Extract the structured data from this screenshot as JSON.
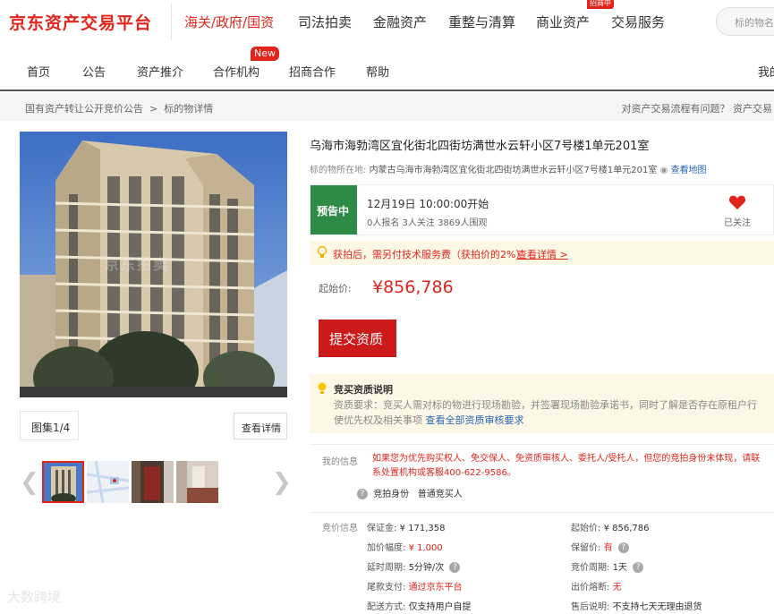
{
  "header": {
    "logo": "京东资产交易平台",
    "nav": [
      "海关/政府/国资",
      "司法拍卖",
      "金融资产",
      "重整与清算",
      "商业资产",
      "交易服务"
    ],
    "badge": "招商中",
    "search_placeholder": "标的物名称"
  },
  "subnav": {
    "items": [
      "首页",
      "公告",
      "资产推介",
      "合作机构",
      "招商合作",
      "帮助"
    ],
    "new_badge": "New",
    "right_text": "我的"
  },
  "breadcrumb": {
    "items": [
      "国有资产转让公开竞价公告",
      "标的物详情"
    ],
    "help": "对资产交易流程有问题？ 资产交易"
  },
  "gallery": {
    "count": "图集1/4",
    "detail_button": "查看详情",
    "photo_watermark": "京东拍卖"
  },
  "item": {
    "title": "乌海市海勃湾区宜化街北四街坊满世水云轩小区7号楼1单元201室",
    "address_label": "标的物所在地:",
    "address": "内蒙古乌海市海勃湾区宜化街北四街坊满世水云轩小区7号楼1单元201室",
    "map_link": "查看地图"
  },
  "status": {
    "tag": "预告中",
    "start_time": "12月19日 10:00:00开始",
    "stats": "0人报名  3人关注  3869人围观",
    "favorite": "已关注"
  },
  "notice": {
    "text": "获拍后，需另付技术服务费（获拍价的2%）",
    "link": "查看详情 >"
  },
  "price": {
    "label": "起始价:",
    "value": "¥856,786"
  },
  "submit_button": "提交资质",
  "qualification": {
    "title": "竞买资质说明",
    "body": "资质要求：竞买人需对标的物进行现场勘验，并签署现场勘验承诺书，同时了解是否存在原租户行使优先权及相关事项",
    "link": "查看全部资质审核要求"
  },
  "my_info": {
    "label": "我的信息",
    "text": "如果您为优先购买权人、免交保人、免资质审核人、委托人/受托人，但您的竞拍身份未体现，请联系处置机构或客服400-622-9586。",
    "identity_label": "竞拍身份",
    "identity_value": "普通竞买人"
  },
  "bid_info": {
    "label": "竞价信息",
    "left": [
      {
        "k": "保证金:",
        "v": "¥ 171,358",
        "red": false,
        "q": false
      },
      {
        "k": "加价幅度:",
        "v": "¥ 1,000",
        "red": true,
        "q": false
      },
      {
        "k": "延时周期:",
        "v": "5分钟/次",
        "red": false,
        "q": true
      },
      {
        "k": "尾款支付:",
        "v": "通过京东平台",
        "red": true,
        "q": false
      },
      {
        "k": "配送方式:",
        "v": "仅支持用户自提",
        "red": false,
        "q": false
      }
    ],
    "right": [
      {
        "k": "起始价:",
        "v": "¥ 856,786",
        "red": false,
        "q": false
      },
      {
        "k": "保留价:",
        "v": "有",
        "red": true,
        "q": true
      },
      {
        "k": "竞价周期:",
        "v": "1天",
        "red": false,
        "q": true
      },
      {
        "k": "出价熔断:",
        "v": "无",
        "red": true,
        "q": false
      },
      {
        "k": "售后说明:",
        "v": "不支持七天无理由退货",
        "red": false,
        "q": false
      }
    ]
  },
  "watermark": "大数跨境",
  "colors": {
    "brand": "#e1251b",
    "status_green": "#2e8b45",
    "link": "#2766b5",
    "notice_bg": "#fdf8e6"
  }
}
